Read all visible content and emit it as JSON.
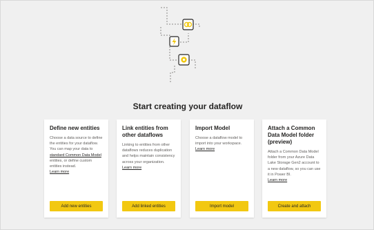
{
  "page": {
    "title": "Start creating your dataflow"
  },
  "cards": [
    {
      "title": "Define new entities",
      "description_before": "Choose a data source to define the entities for your dataflow. You can map your data to ",
      "description_link": "standard Common Data Model",
      "description_after": " entities, or define custom entities instead.",
      "learn_more": "Learn more",
      "button": "Add new entities"
    },
    {
      "title": "Link entities from other dataflows",
      "description": "Linking to entities from other dataflows reduces duplication and helps maintain consistency across your organization.",
      "learn_more": "Learn more",
      "button": "Add linked entities"
    },
    {
      "title": "Import Model",
      "description": "Choose a dataflow model to import into your workspace.",
      "learn_more": "Learn more",
      "button": "Import model"
    },
    {
      "title": "Attach a Common Data Model folder (preview)",
      "description": "Attach a Common Data Model folder from your Azure Data Lake Storage Gen2 account to a new dataflow, so you can use it in Power BI.",
      "learn_more": "Learn more",
      "button": "Create and attach"
    }
  ],
  "illustration": {
    "icons": [
      "link-icon",
      "lightning-icon",
      "gear-icon"
    ],
    "accent_color": "#f2c811"
  }
}
